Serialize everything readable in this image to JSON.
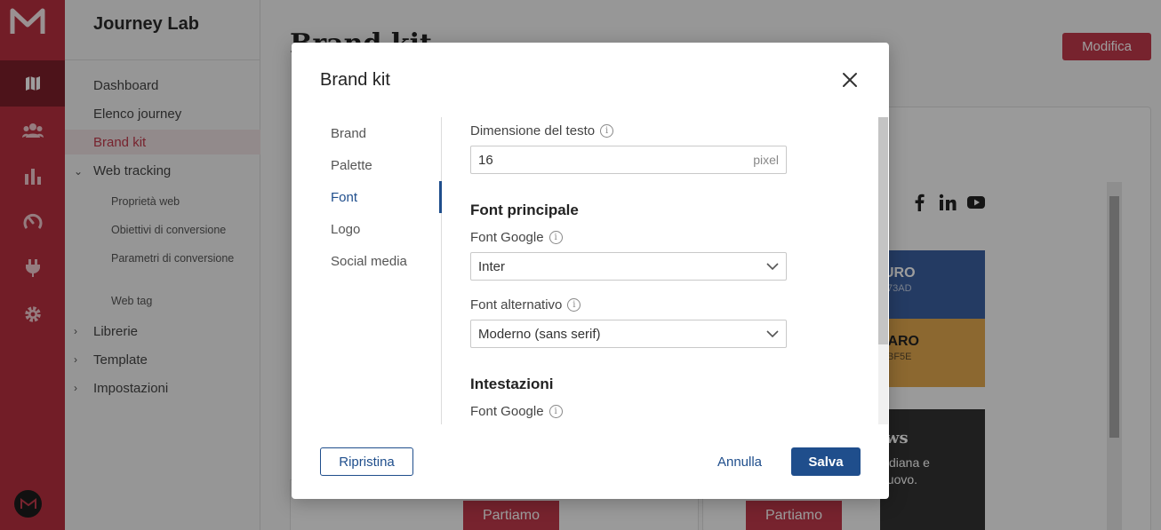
{
  "app": {
    "name": "Journey Lab"
  },
  "rail": {
    "icons": [
      "logo-m-icon",
      "map-icon",
      "users-icon",
      "bar-chart-icon",
      "gauge-icon",
      "plug-icon",
      "gear-icon"
    ],
    "active": "map-icon"
  },
  "sidebar": {
    "title": "Journey Lab",
    "items": [
      {
        "label": "Dashboard"
      },
      {
        "label": "Elenco journey"
      },
      {
        "label": "Brand kit",
        "active": true
      }
    ],
    "web_tracking": {
      "label": "Web tracking",
      "children": [
        "Proprietà web",
        "Obiettivi di conversione",
        "Parametri di conversione",
        "Web tag"
      ]
    },
    "groups": [
      {
        "label": "Librerie"
      },
      {
        "label": "Template"
      },
      {
        "label": "Impostazioni"
      }
    ]
  },
  "page": {
    "title": "Brand kit",
    "edit_button": "Modifica",
    "preview": {
      "swatch_primary": {
        "name": "URO",
        "hex": "73AD",
        "color": "#3a5fa0"
      },
      "swatch_secondary": {
        "name": "IARO",
        "hex": "BF5E",
        "color": "#e3a94e"
      },
      "card_title": "ws",
      "card_text_1": "diana e",
      "card_text_2": "nuovo.",
      "cta": "Partiamo"
    }
  },
  "modal": {
    "title": "Brand kit",
    "nav": [
      {
        "label": "Brand"
      },
      {
        "label": "Palette"
      },
      {
        "label": "Font",
        "active": true
      },
      {
        "label": "Logo"
      },
      {
        "label": "Social media"
      }
    ],
    "text_size": {
      "label": "Dimensione del testo",
      "value": "16",
      "suffix": "pixel"
    },
    "main_font": {
      "heading": "Font principale",
      "google_label": "Font Google",
      "google_value": "Inter",
      "fallback_label": "Font alternativo",
      "fallback_value": "Moderno (sans serif)"
    },
    "headings": {
      "heading": "Intestazioni",
      "google_label": "Font Google"
    },
    "buttons": {
      "reset": "Ripristina",
      "cancel": "Annulla",
      "save": "Salva"
    }
  },
  "colors": {
    "brand_red": "#b8303f",
    "primary_blue": "#1f4e8c"
  }
}
